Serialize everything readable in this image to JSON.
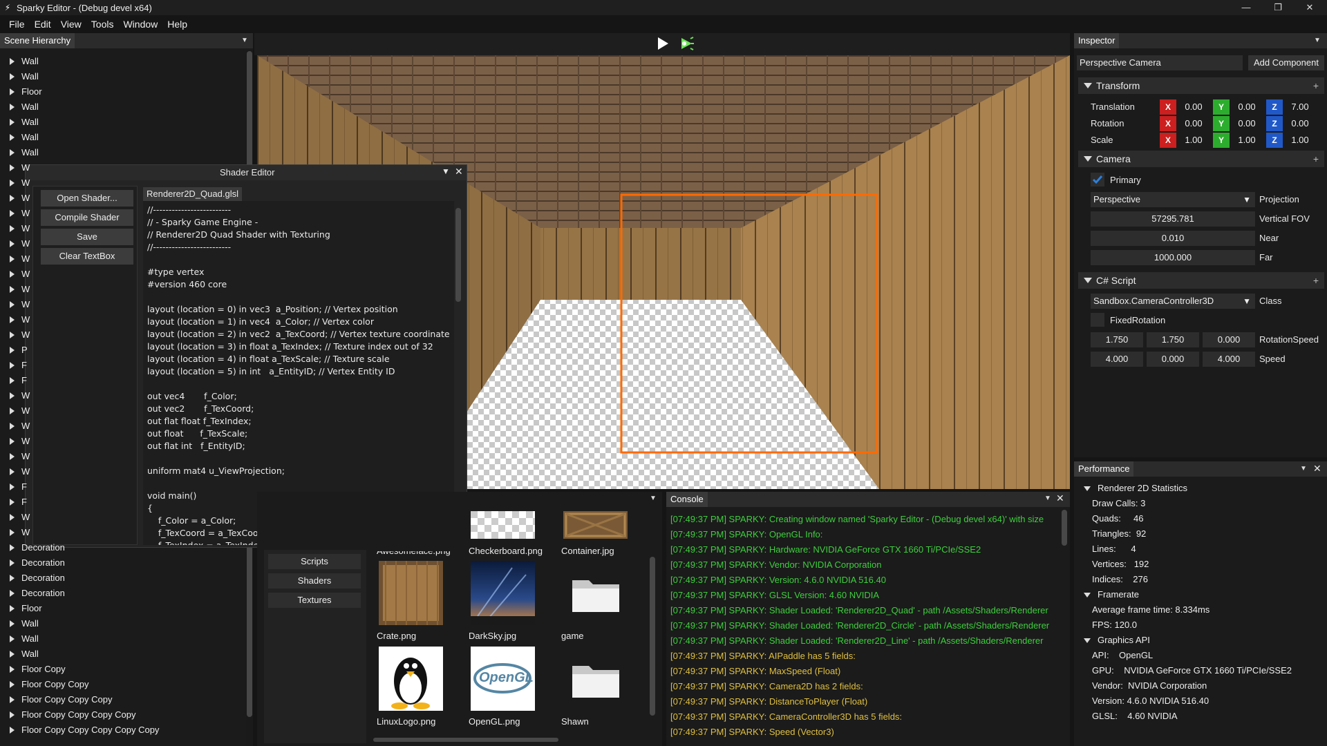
{
  "window": {
    "title": "Sparky Editor - (Debug devel x64)",
    "minimize": "—",
    "restore": "❐",
    "close": "✕"
  },
  "menu": [
    "File",
    "Edit",
    "View",
    "Tools",
    "Window",
    "Help"
  ],
  "hierarchy": {
    "title": "Scene Hierarchy",
    "items_top": [
      "Wall",
      "Wall",
      "Floor",
      "Wall",
      "Wall",
      "Wall",
      "Wall"
    ],
    "items_hidden": [
      "W",
      "W",
      "W",
      "W",
      "W",
      "W",
      "W",
      "W",
      "W",
      "W",
      "W",
      "W",
      "P",
      "F",
      "F",
      "W",
      "W",
      "W",
      "W",
      "W",
      "W",
      "F",
      "F",
      "W",
      "W"
    ],
    "items_bottom": [
      "Decoration",
      "Decoration",
      "Decoration",
      "Decoration",
      "Floor",
      "Wall",
      "Wall",
      "Wall",
      "Floor Copy",
      "Floor Copy Copy",
      "Floor Copy Copy Copy",
      "Floor Copy Copy Copy Copy",
      "Floor Copy Copy Copy Copy Copy"
    ]
  },
  "toolbar": {
    "play_icon": "play-icon",
    "simulate_icon": "simulate-icon"
  },
  "shader_editor": {
    "title": "Shader Editor",
    "buttons": [
      "Open Shader...",
      "Compile Shader",
      "Save",
      "Clear TextBox"
    ],
    "file_tab": "Renderer2D_Quad.glsl",
    "code": "//-------------------------\n// - Sparky Game Engine -\n// Renderer2D Quad Shader with Texturing\n//-------------------------\n\n#type vertex\n#version 460 core\n\nlayout (location = 0) in vec3  a_Position; // Vertex position\nlayout (location = 1) in vec4  a_Color; // Vertex color\nlayout (location = 2) in vec2  a_TexCoord; // Vertex texture coordinate\nlayout (location = 3) in float a_TexIndex; // Texture index out of 32\nlayout (location = 4) in float a_TexScale; // Texture scale\nlayout (location = 5) in int   a_EntityID; // Vertex Entity ID\n\nout vec4       f_Color;\nout vec2       f_TexCoord;\nout flat float f_TexIndex;\nout float      f_TexScale;\nout flat int   f_EntityID;\n\nuniform mat4 u_ViewProjection;\n\nvoid main()\n{\n    f_Color = a_Color;\n    f_TexCoord = a_TexCoord;\n    f_TexIndex = a_TexIndex;"
  },
  "inspector": {
    "title": "Inspector",
    "entity_name": "Perspective Camera",
    "add_component": "Add Component",
    "transform": {
      "label": "Transform",
      "rows": [
        {
          "label": "Translation",
          "x": "0.00",
          "y": "0.00",
          "z": "7.00"
        },
        {
          "label": "Rotation",
          "x": "0.00",
          "y": "0.00",
          "z": "0.00"
        },
        {
          "label": "Scale",
          "x": "1.00",
          "y": "1.00",
          "z": "1.00"
        }
      ]
    },
    "camera": {
      "label": "Camera",
      "primary_label": "Primary",
      "primary": true,
      "projection_value": "Perspective",
      "projection_label": "Projection",
      "fov": "57295.781",
      "fov_label": "Vertical FOV",
      "near": "0.010",
      "near_label": "Near",
      "far": "1000.000",
      "far_label": "Far"
    },
    "script": {
      "label": "C# Script",
      "class_value": "Sandbox.CameraController3D",
      "class_label": "Class",
      "fixed_rotation_label": "FixedRotation",
      "rotation_speed": [
        "1.750",
        "1.750",
        "0.000"
      ],
      "rotation_speed_label": "RotationSpeed",
      "speed": [
        "4.000",
        "0.000",
        "4.000"
      ],
      "speed_label": "Speed"
    }
  },
  "performance": {
    "title": "Performance",
    "renderer_label": "Renderer 2D Statistics",
    "stats": [
      "Draw Calls: 3",
      "Quads:     46",
      "Triangles:  92",
      "Lines:      4",
      "Vertices:   192",
      "Indices:    276"
    ],
    "framerate_label": "Framerate",
    "framerate": [
      "Average frame time: 8.334ms",
      "FPS: 120.0"
    ],
    "api_label": "Graphics API",
    "api": [
      "API:    OpenGL",
      "GPU:    NVIDIA GeForce GTX 1660 Ti/PCIe/SSE2",
      "Vendor:  NVIDIA Corporation",
      "Version: 4.6.0 NVIDIA 516.40",
      "GLSL:    4.60 NVIDIA"
    ]
  },
  "content_browser": {
    "categories": [
      "Scripts",
      "Shaders",
      "Textures"
    ],
    "top_labels": [
      "Awesomeface.png",
      "Checkerboard.png",
      "Container.jpg"
    ],
    "assets": [
      {
        "name": "Crate.png",
        "icon": "crate-icon"
      },
      {
        "name": "DarkSky.jpg",
        "icon": "darksky-icon"
      },
      {
        "name": "game",
        "icon": "folder-icon"
      },
      {
        "name": "LinuxLogo.png",
        "icon": "tux-icon"
      },
      {
        "name": "OpenGL.png",
        "icon": "opengl-icon"
      },
      {
        "name": "Shawn",
        "icon": "folder-icon"
      }
    ],
    "opengl_logo_text": "OpenGL"
  },
  "console": {
    "title": "Console",
    "lines": [
      {
        "text": "[07:49:37 PM]  SPARKY: Creating window named 'Sparky Editor - (Debug devel x64)' with size",
        "color": "#3ecf3e"
      },
      {
        "text": "[07:49:37 PM]  SPARKY: OpenGL Info:",
        "color": "#3ecf3e"
      },
      {
        "text": "[07:49:37 PM]  SPARKY:   Hardware:     NVIDIA GeForce GTX 1660 Ti/PCIe/SSE2",
        "color": "#3ecf3e"
      },
      {
        "text": "[07:49:37 PM]  SPARKY:   Vendor:      NVIDIA Corporation",
        "color": "#3ecf3e"
      },
      {
        "text": "[07:49:37 PM]  SPARKY:   Version:      4.6.0 NVIDIA 516.40",
        "color": "#3ecf3e"
      },
      {
        "text": "[07:49:37 PM]  SPARKY:   GLSL Version: 4.60 NVIDIA",
        "color": "#3ecf3e"
      },
      {
        "text": "[07:49:37 PM]  SPARKY: Shader Loaded: 'Renderer2D_Quad' - path /Assets/Shaders/Renderer",
        "color": "#3ecf3e"
      },
      {
        "text": "[07:49:37 PM]  SPARKY: Shader Loaded: 'Renderer2D_Circle' - path /Assets/Shaders/Renderer",
        "color": "#3ecf3e"
      },
      {
        "text": "[07:49:37 PM]  SPARKY: Shader Loaded: 'Renderer2D_Line' - path /Assets/Shaders/Renderer",
        "color": "#3ecf3e"
      },
      {
        "text": "[07:49:37 PM]  SPARKY: AIPaddle has 5 fields:",
        "color": "#e0c040"
      },
      {
        "text": "[07:49:37 PM]  SPARKY:   MaxSpeed (Float)",
        "color": "#e0c040"
      },
      {
        "text": "[07:49:37 PM]  SPARKY: Camera2D has 2 fields:",
        "color": "#e0c040"
      },
      {
        "text": "[07:49:37 PM]  SPARKY:   DistanceToPlayer (Float)",
        "color": "#e0c040"
      },
      {
        "text": "[07:49:37 PM]  SPARKY: CameraController3D has 5 fields:",
        "color": "#e0c040"
      },
      {
        "text": "[07:49:37 PM]  SPARKY:   Speed (Vector3)",
        "color": "#e0c040"
      }
    ]
  },
  "colors": {
    "accent": "#2f7fd8",
    "x_axis": "#cc1f1f",
    "y_axis": "#2dad2d",
    "z_axis": "#2058c8",
    "selection": "#ff6a00"
  }
}
